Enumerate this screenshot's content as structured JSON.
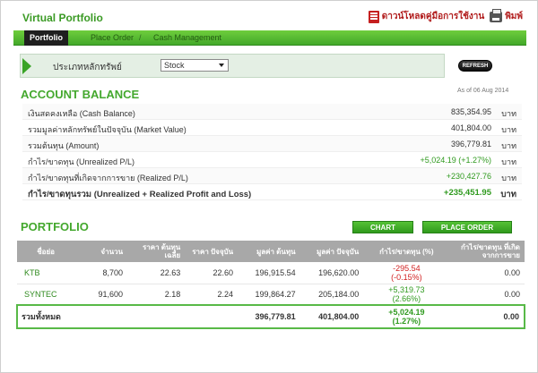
{
  "header": {
    "app_title": "Virtual Portfolio",
    "download_manual": "ดาวน์โหลดคู่มือการใช้งาน",
    "print": "พิมพ์"
  },
  "tabs": [
    {
      "label": "Portfolio",
      "active": true
    },
    {
      "label": "Place Order",
      "active": false
    },
    {
      "label": "Cash Management",
      "active": false
    }
  ],
  "tab_separator": "/",
  "filter": {
    "label": "ประเภทหลักทรัพย์",
    "selected": "Stock"
  },
  "refresh_label": "REFRESH",
  "account_balance": {
    "title": "ACCOUNT BALANCE",
    "as_of": "As of 06 Aug 2014",
    "unit": "บาท",
    "rows": [
      {
        "label": "เงินสดคงเหลือ (Cash Balance)",
        "value": "835,354.95"
      },
      {
        "label": "รวมมูลค่าหลักทรัพย์ในปัจจุบัน (Market Value)",
        "value": "401,804.00"
      },
      {
        "label": "รวมต้นทุน (Amount)",
        "value": "396,779.81"
      },
      {
        "label": "กำไร/ขาดทุน (Unrealized P/L)",
        "value": "+5,024.19 (+1.27%)"
      },
      {
        "label": "กำไร/ขาดทุนที่เกิดจากการขาย (Realized P/L)",
        "value": "+230,427.76"
      },
      {
        "label": "กำไร/ขาดทุนรวม (Unrealized + Realized Profit and Loss)",
        "value": "+235,451.95"
      }
    ]
  },
  "portfolio": {
    "title": "PORTFOLIO",
    "chart_button": "CHART",
    "place_order_button": "PLACE ORDER",
    "columns": [
      "ชื่อย่อ",
      "จำนวน",
      "ราคา ต้นทุนเฉลี่ย",
      "ราคา ปัจจุบัน",
      "มูลค่า ต้นทุน",
      "มูลค่า ปัจจุบัน",
      "กำไร/ขาดทุน (%)",
      "กำไร/ขาดทุน ที่เกิดจากการขาย"
    ],
    "rows": [
      {
        "symbol": "KTB",
        "qty": "8,700",
        "avg_cost": "22.63",
        "price": "22.60",
        "cost_value": "196,915.54",
        "market_value": "196,620.00",
        "pl": "-295.54",
        "pl_pct": "(-0.15%)",
        "realized": "0.00"
      },
      {
        "symbol": "SYNTEC",
        "qty": "91,600",
        "avg_cost": "2.18",
        "price": "2.24",
        "cost_value": "199,864.27",
        "market_value": "205,184.00",
        "pl": "+5,319.73",
        "pl_pct": "(2.66%)",
        "realized": "0.00"
      }
    ],
    "total": {
      "label": "รวมทั้งหมด",
      "cost_value": "396,779.81",
      "market_value": "401,804.00",
      "pl": "+5,024.19",
      "pl_pct": "(1.27%)",
      "realized": "0.00"
    }
  }
}
